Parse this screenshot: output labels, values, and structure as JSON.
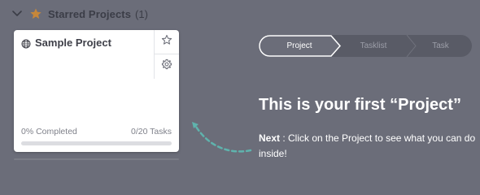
{
  "section": {
    "title": "Starred Projects",
    "count": "(1)",
    "chevron_icon": "chevron-down-icon",
    "star_icon": "star-filled-icon",
    "star_color": "#c6873a"
  },
  "card": {
    "title": "Sample Project",
    "globe_icon": "globe-icon",
    "actions": [
      {
        "icon": "star-outline-icon"
      },
      {
        "icon": "gear-icon"
      }
    ],
    "completed_text": "0% Completed",
    "tasks_text": "0/20 Tasks",
    "progress": 0
  },
  "stepper": {
    "steps": [
      "Project",
      "Tasklist",
      "Task"
    ],
    "active_index": 0
  },
  "onboarding": {
    "title": "This is your first “Project”",
    "next_label": "Next",
    "description": " : Click on the Project to see what you can do inside!",
    "accent_color": "#5fb3ad"
  }
}
